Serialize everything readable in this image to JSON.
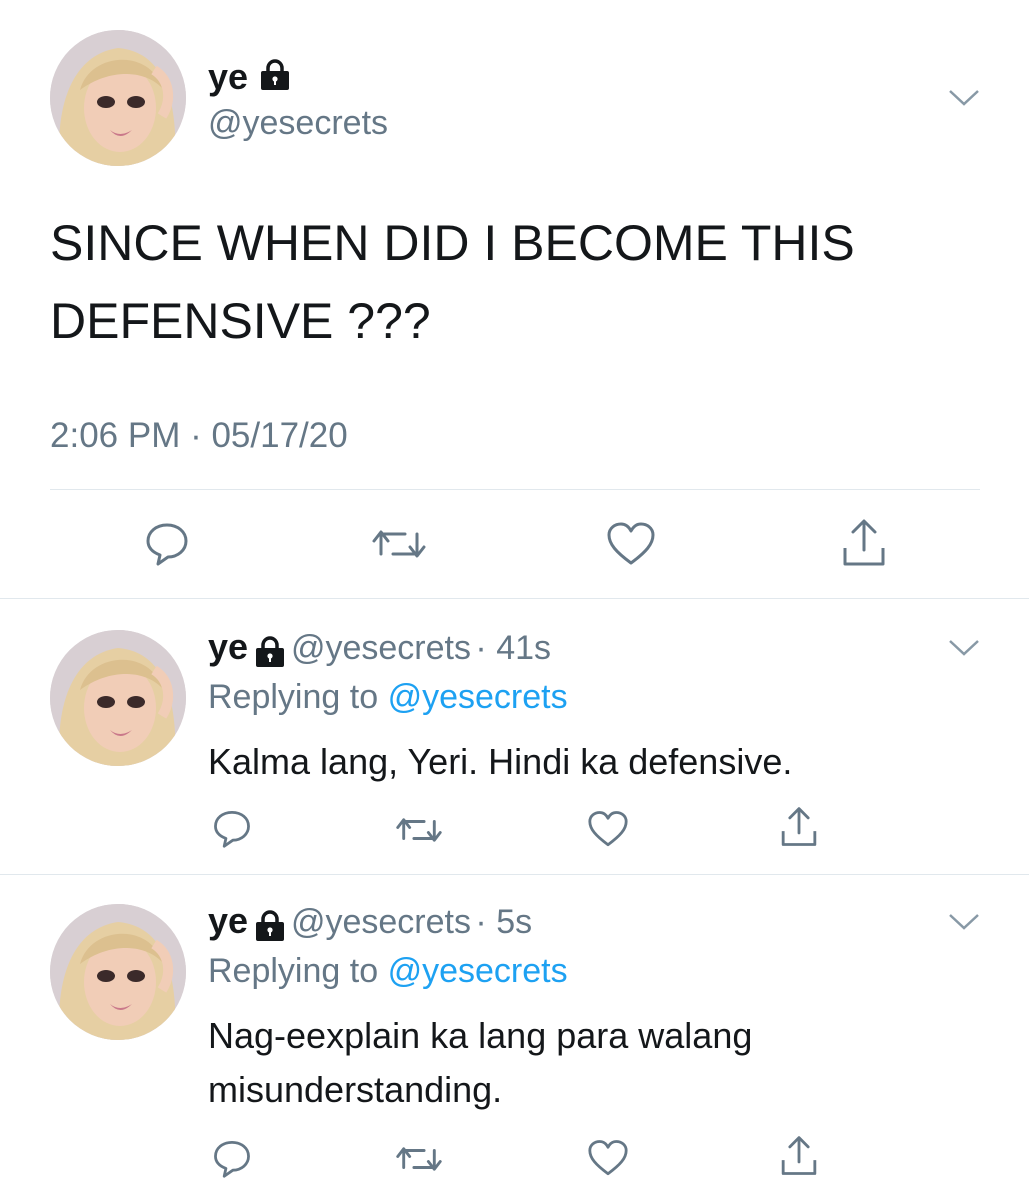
{
  "main_tweet": {
    "display_name": "ye",
    "handle": "@yesecrets",
    "text_line1": "SINCE WHEN DID I BECOME THIS",
    "text_line2": "DEFENSIVE ???",
    "timestamp": "2:06 PM · 05/17/20"
  },
  "replies": [
    {
      "display_name": "ye",
      "handle": "@yesecrets",
      "time": "· 41s",
      "replying_prefix": "Replying to",
      "replying_to": "@yesecrets",
      "text_line1": "Kalma lang, Yeri. Hindi ka defensive.",
      "text_line2": ""
    },
    {
      "display_name": "ye",
      "handle": "@yesecrets",
      "time": "· 5s",
      "replying_prefix": "Replying to",
      "replying_to": "@yesecrets",
      "text_line1": "Nag-eexplain ka lang para walang",
      "text_line2": "misunderstanding."
    }
  ],
  "icons": {
    "reply": "comment-icon",
    "retweet": "retweet-icon",
    "like": "heart-icon",
    "share": "share-icon",
    "more": "chevron-down-icon",
    "protected": "lock-icon"
  },
  "colors": {
    "text": "#14171a",
    "secondary": "#657786",
    "link": "#1da1f2",
    "divider": "#e1e8ed"
  }
}
